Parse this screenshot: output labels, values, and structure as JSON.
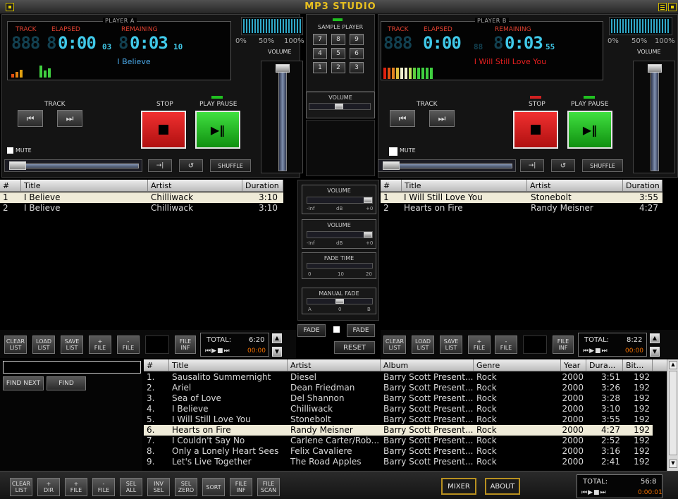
{
  "app": {
    "title": "MP3 STUDIO"
  },
  "player_a": {
    "legend": "PLAYER A",
    "track_label": "TRACK",
    "elapsed_label": "ELAPSED",
    "remaining_label": "REMAINING",
    "track_digits": "888",
    "elapsed_digits": "0:00",
    "elapsed_frac": "03",
    "remaining_digits": "0:03",
    "remaining_frac": "10",
    "song": "I Believe",
    "song_color": "#4aa8e8",
    "meter_scale": [
      "0%",
      "50%",
      "100%"
    ],
    "volume_label": "VOLUME",
    "track_btn_label": "TRACK",
    "stop_label": "STOP",
    "play_label": "PLAY PAUSE",
    "mute_label": "MUTE",
    "shuffle_label": "SHUFFLE"
  },
  "player_b": {
    "legend": "PLAYER B",
    "track_label": "TRACK",
    "elapsed_label": "ELAPSED",
    "remaining_label": "REMAINING",
    "track_digits": "888",
    "elapsed_digits": "0:00",
    "elapsed_frac": "88",
    "remaining_digits": "0:03",
    "remaining_frac": "55",
    "song": "I Will Still Love You",
    "song_color": "#e82020",
    "meter_scale": [
      "0%",
      "50%",
      "100%"
    ],
    "volume_label": "VOLUME",
    "track_btn_label": "TRACK",
    "stop_label": "STOP",
    "play_label": "PLAY PAUSE",
    "mute_label": "MUTE",
    "shuffle_label": "SHUFFLE"
  },
  "sample_player": {
    "title": "SAMPLE PLAYER",
    "keys": [
      "7",
      "8",
      "9",
      "4",
      "5",
      "6",
      "1",
      "2",
      "3"
    ],
    "volume_label": "VOLUME"
  },
  "mixer_center": {
    "vol1": {
      "title": "VOLUME",
      "left": "-Inf",
      "mid": "dB",
      "right": "+0"
    },
    "vol2": {
      "title": "VOLUME",
      "left": "-Inf",
      "mid": "dB",
      "right": "+0"
    },
    "fade_time": {
      "title": "FADE TIME",
      "left": "0",
      "mid": "10",
      "right": "20"
    },
    "manual_fade": {
      "title": "MANUAL FADE",
      "left": "A",
      "mid": "0",
      "right": "B"
    },
    "fade_left": "FADE",
    "fade_right": "FADE",
    "reset": "RESET"
  },
  "playlist_a": {
    "headers": [
      "#",
      "Title",
      "Artist",
      "Duration"
    ],
    "rows": [
      [
        "1",
        "I Believe",
        "Chilliwack",
        "3:10"
      ],
      [
        "2",
        "I Believe",
        "Chilliwack",
        "3:10"
      ]
    ],
    "total_label": "TOTAL:",
    "total": "6:20",
    "time": "00:00"
  },
  "playlist_b": {
    "headers": [
      "#",
      "Title",
      "Artist",
      "Duration"
    ],
    "rows": [
      [
        "1",
        "I Will Still Love You",
        "Stonebolt",
        "3:55"
      ],
      [
        "2",
        "Hearts on Fire",
        "Randy Meisner",
        "4:27"
      ]
    ],
    "total_label": "TOTAL:",
    "total": "8:22",
    "time": "00:00"
  },
  "list_buttons": [
    [
      "CLEAR",
      "LIST"
    ],
    [
      "LOAD",
      "LIST"
    ],
    [
      "SAVE",
      "LIST"
    ],
    [
      "+",
      "FILE"
    ],
    [
      "-",
      "FILE"
    ],
    [
      "FILE",
      "INF"
    ]
  ],
  "search": {
    "find_next": "FIND NEXT",
    "find": "FIND",
    "value": ""
  },
  "library": {
    "headers": [
      "#",
      "Title",
      "Artist",
      "Album",
      "Genre",
      "Year",
      "Dura...",
      "Bit..."
    ],
    "rows": [
      [
        "1.",
        "Sausalito Summernight",
        "Diesel",
        "Barry Scott Present...",
        "Rock",
        "2000",
        "3:51",
        "192"
      ],
      [
        "2.",
        "Ariel",
        "Dean Friedman",
        "Barry Scott Present...",
        "Rock",
        "2000",
        "3:26",
        "192"
      ],
      [
        "3.",
        "Sea of Love",
        "Del Shannon",
        "Barry Scott Present...",
        "Rock",
        "2000",
        "3:28",
        "192"
      ],
      [
        "4.",
        "I Believe",
        "Chilliwack",
        "Barry Scott Present...",
        "Rock",
        "2000",
        "3:10",
        "192"
      ],
      [
        "5.",
        "I Will Still Love You",
        "Stonebolt",
        "Barry Scott Present...",
        "Rock",
        "2000",
        "3:55",
        "192"
      ],
      [
        "6.",
        "Hearts on Fire",
        "Randy Meisner",
        "Barry Scott Present...",
        "Rock",
        "2000",
        "4:27",
        "192"
      ],
      [
        "7.",
        "I Couldn't Say No",
        "Carlene Carter/Rob...",
        "Barry Scott Present...",
        "Rock",
        "2000",
        "2:52",
        "192"
      ],
      [
        "8.",
        "Only a Lonely Heart Sees",
        "Felix Cavaliere",
        "Barry Scott Present...",
        "Rock",
        "2000",
        "3:16",
        "192"
      ],
      [
        "9.",
        "Let's Live Together",
        "The Road Apples",
        "Barry Scott Present...",
        "Rock",
        "2000",
        "2:41",
        "192"
      ]
    ],
    "selected_index": 5
  },
  "bottom_buttons": [
    [
      "CLEAR",
      "LIST"
    ],
    [
      "+",
      "DIR"
    ],
    [
      "+",
      "FILE"
    ],
    [
      "-",
      "FILE"
    ],
    [
      "SEL",
      "ALL"
    ],
    [
      "INV",
      "SEL"
    ],
    [
      "SEL",
      "ZERO"
    ],
    [
      "SORT",
      ""
    ],
    [
      "FILE",
      "INF"
    ],
    [
      "FILE",
      "SCAN"
    ]
  ],
  "mixer_btn": "MIXER",
  "about_btn": "ABOUT",
  "bottom_total": {
    "label": "TOTAL:",
    "value": "56:8",
    "time": "0:00:01"
  }
}
